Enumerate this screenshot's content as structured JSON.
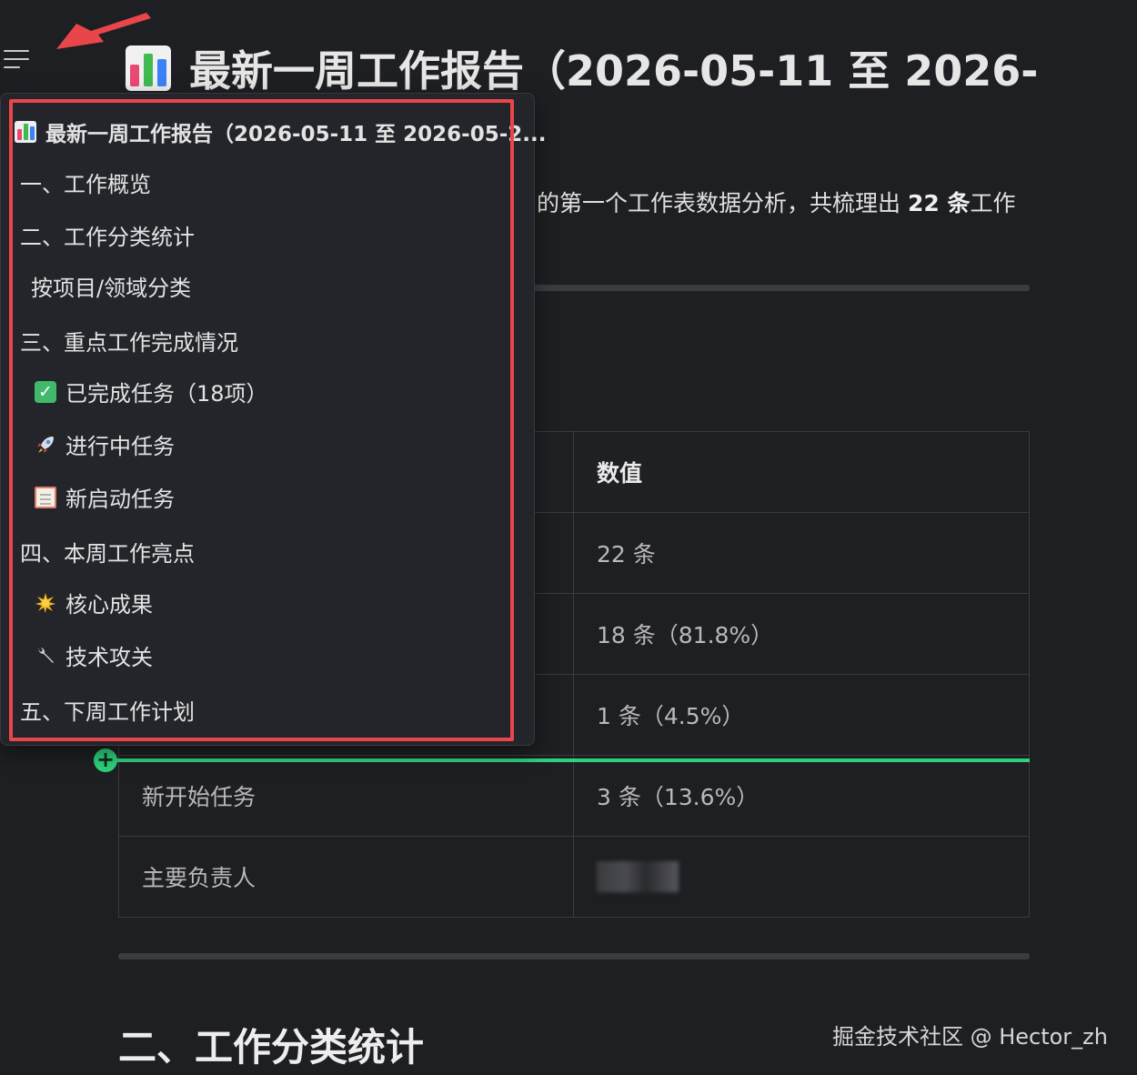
{
  "document": {
    "title": "最新一周工作报告（2026-05-11 至 2026-",
    "intro_prefix": "的第一个工作表数据分析，共梳理出 ",
    "intro_count": "22 条",
    "intro_suffix": "工作",
    "section2_heading": "二、工作分类统计"
  },
  "table": {
    "header_value": "数值",
    "rows": [
      {
        "label": "",
        "value": "22 条"
      },
      {
        "label": "",
        "value": "18 条（81.8%）"
      },
      {
        "label": "",
        "value": "1 条（4.5%）"
      },
      {
        "label": "新开始任务",
        "value": "3 条（13.6%）"
      },
      {
        "label": "主要负责人",
        "value": ""
      }
    ]
  },
  "outline": {
    "items": [
      {
        "label": "最新一周工作报告（2026-05-11 至 2026-05-2...",
        "icon": "bar-chart-icon"
      },
      {
        "label": "一、工作概览"
      },
      {
        "label": "二、工作分类统计"
      },
      {
        "label": "按项目/领域分类"
      },
      {
        "label": "三、重点工作完成情况"
      },
      {
        "label": "已完成任务（18项）",
        "icon": "check-mark-icon"
      },
      {
        "label": "进行中任务",
        "icon": "rocket-icon"
      },
      {
        "label": "新启动任务",
        "icon": "clipboard-icon"
      },
      {
        "label": "四、本周工作亮点"
      },
      {
        "label": "核心成果",
        "icon": "sparkle-icon"
      },
      {
        "label": "技术攻关",
        "icon": "wrench-icon"
      },
      {
        "label": "五、下周工作计划"
      }
    ]
  },
  "watermark": "掘金技术社区 @ Hector_zh",
  "colors": {
    "background": "#1e1f22",
    "highlight_frame": "#e8464a",
    "insert_line": "#2fd17c",
    "annotation_arrow": "#e8464a"
  }
}
